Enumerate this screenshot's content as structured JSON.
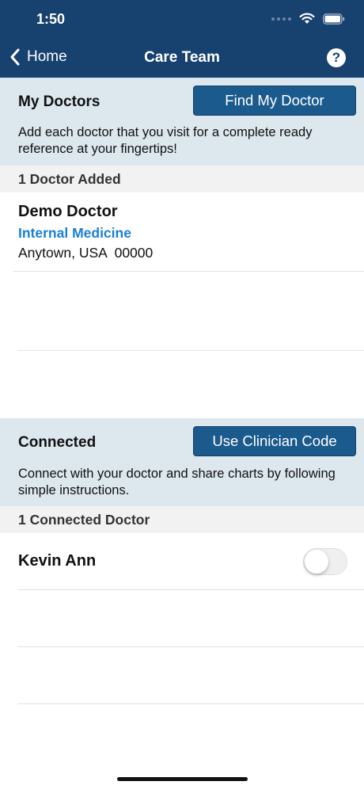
{
  "status_bar": {
    "time": "1:50"
  },
  "nav": {
    "back_label": "Home",
    "title": "Care Team",
    "help_icon": "?"
  },
  "my_doctors": {
    "title": "My Doctors",
    "button_label": "Find My Doctor",
    "description": "Add each doctor that you visit for a complete ready reference at your fingertips!",
    "count_label": "1 Doctor Added",
    "doctors": [
      {
        "name": "Demo Doctor",
        "specialty": "Internal Medicine",
        "location": "Anytown, USA  00000"
      }
    ]
  },
  "connected": {
    "title": "Connected",
    "button_label": "Use Clinician Code",
    "description": "Connect with your doctor and share charts by following simple instructions.",
    "count_label": "1 Connected Doctor",
    "doctors": [
      {
        "name": "Kevin Ann",
        "sharing_enabled": false
      }
    ]
  },
  "colors": {
    "header": "#17416f",
    "button": "#1b5a8c",
    "section_bg": "#dce7ee",
    "link": "#1a7fd8"
  }
}
